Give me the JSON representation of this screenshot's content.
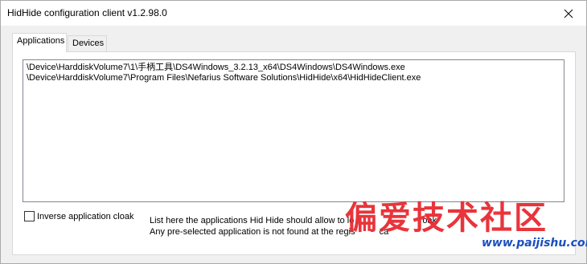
{
  "window": {
    "title": "HidHide configuration client v1.2.98.0"
  },
  "tabs": [
    {
      "label": "Applications",
      "active": true
    },
    {
      "label": "Devices",
      "active": false
    }
  ],
  "applications": {
    "list": [
      "\\Device\\HarddiskVolume7\\1\\手柄工具\\DS4Windows_3.2.13_x64\\DS4Windows\\DS4Windows.exe",
      "\\Device\\HarddiskVolume7\\Program Files\\Nefarius Software Solutions\\HidHide\\x64\\HidHideClient.exe"
    ],
    "inverse_cloak_label": "Inverse application cloak",
    "inverse_cloak_checked": false,
    "info_line1": "List here the applications Hid Hide should allow to lo",
    "info_line1_tail": "oak",
    "info_line2": "Any pre-selected application is not found at the regis",
    "info_line2_tail": "ca"
  },
  "watermark": {
    "text": "偏爱技术社区",
    "url": "www.paijishu.com"
  },
  "colors": {
    "watermark_red": "#e8232b",
    "watermark_blue": "#1a4fbf"
  }
}
